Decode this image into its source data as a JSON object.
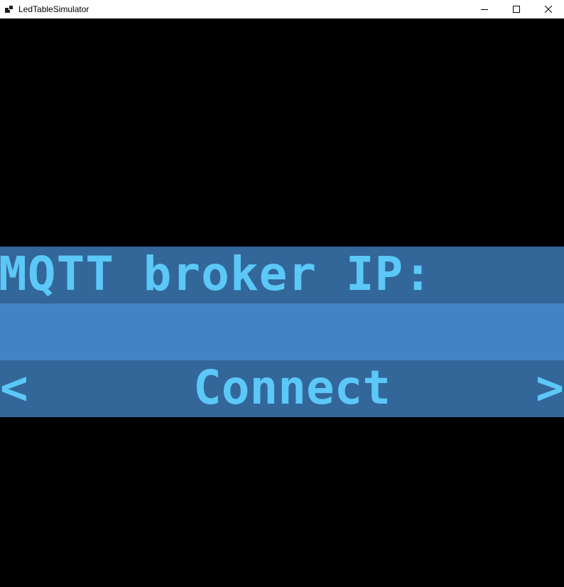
{
  "window": {
    "title": "LedTableSimulator",
    "controls": {
      "minimize": "minimize-icon",
      "maximize": "maximize-icon",
      "close": "close-icon"
    }
  },
  "screen": {
    "label": "MQTT broker IP:",
    "input_value": "",
    "nav": {
      "prev": "<",
      "action": "Connect",
      "next": ">"
    }
  },
  "colors": {
    "background": "#000000",
    "band_dark": "#336699",
    "band_light": "#4183c4",
    "led_text": "#5bc8f7"
  }
}
